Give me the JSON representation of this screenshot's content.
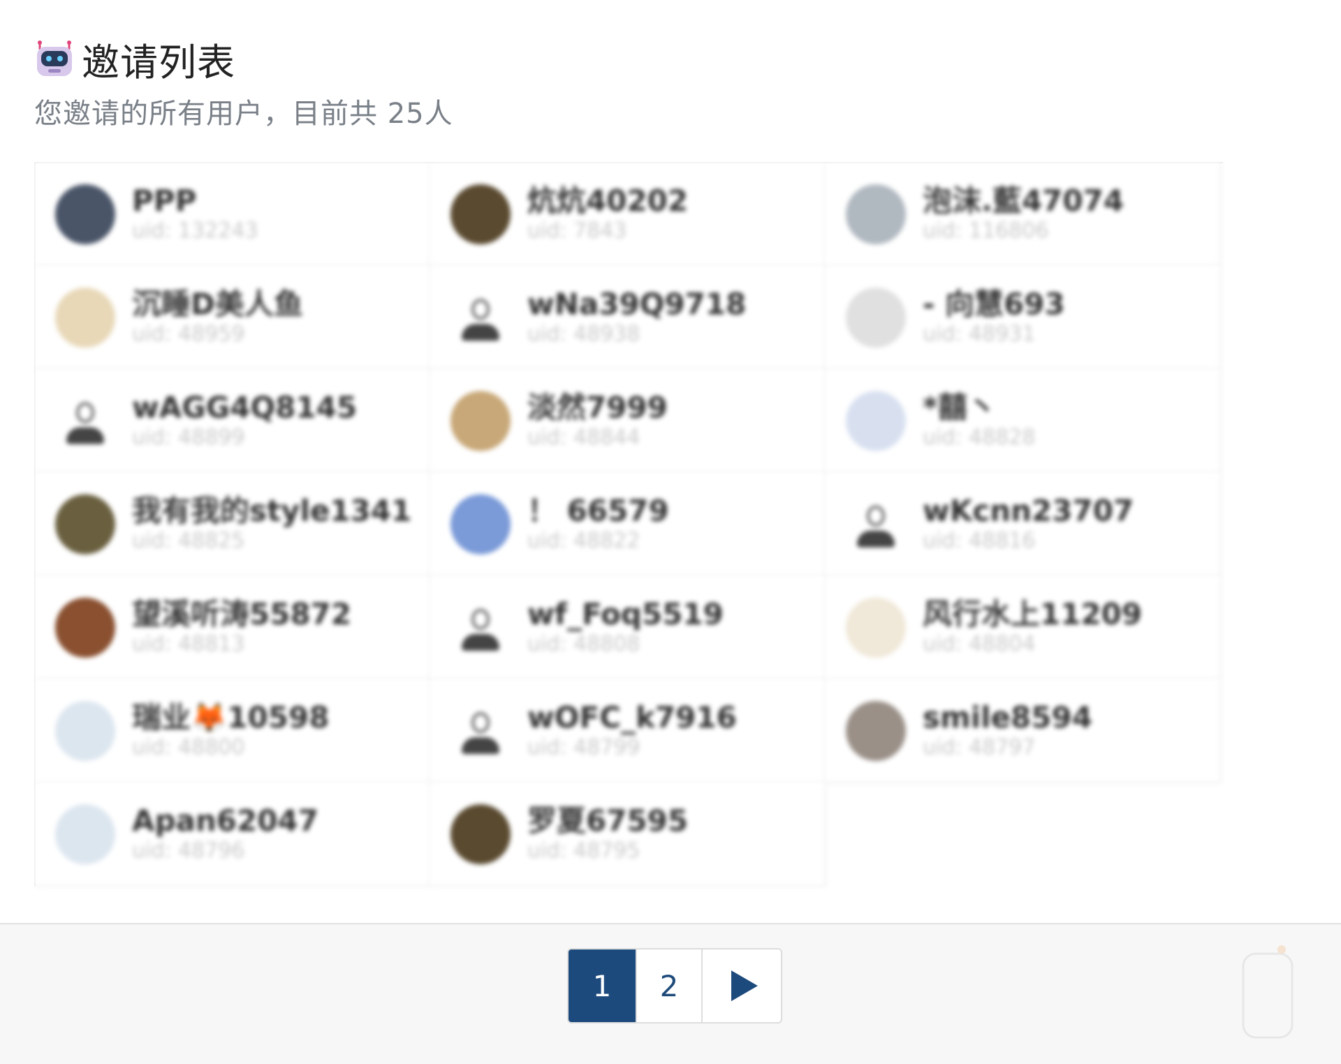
{
  "header": {
    "icon": "robot-icon",
    "title": "邀请列表",
    "subtitle": "您邀请的所有用户，目前共 25人"
  },
  "invites": [
    {
      "name": "PPP",
      "uid": "uid: 132243",
      "avatar": "photo-icon",
      "color": "#4a5568"
    },
    {
      "name": "炕炕40202",
      "uid": "uid: 7843",
      "avatar": "photo-icon",
      "color": "#5a4a30"
    },
    {
      "name": "泡沫.藍47074",
      "uid": "uid: 116806",
      "avatar": "photo-icon",
      "color": "#b0b8c0"
    },
    {
      "name": "沉睡D美人鱼",
      "uid": "uid: 48959",
      "avatar": "photo-icon",
      "color": "#e8d8b8"
    },
    {
      "name": "wNa39Q9718",
      "uid": "uid: 48938",
      "avatar": "default-user-icon",
      "color": "#ffffff"
    },
    {
      "name": "- 向慧693",
      "uid": "uid: 48931",
      "avatar": "photo-icon",
      "color": "#e0e0e0"
    },
    {
      "name": "wAGG4Q8145",
      "uid": "uid: 48899",
      "avatar": "default-user-icon",
      "color": "#ffffff"
    },
    {
      "name": "淡然7999",
      "uid": "uid: 48844",
      "avatar": "photo-icon",
      "color": "#c8a878"
    },
    {
      "name": "*囍丶",
      "uid": "uid: 48828",
      "avatar": "photo-icon",
      "color": "#d8e0f0"
    },
    {
      "name": "我有我的style1341",
      "uid": "uid: 48825",
      "avatar": "photo-icon",
      "color": "#6a6040"
    },
    {
      "name": "！ 66579",
      "uid": "uid: 48822",
      "avatar": "photo-icon",
      "color": "#7a9ad8"
    },
    {
      "name": "wKcnn23707",
      "uid": "uid: 48816",
      "avatar": "default-user-icon",
      "color": "#ffffff"
    },
    {
      "name": "望溪听涛55872",
      "uid": "uid: 48813",
      "avatar": "photo-icon",
      "color": "#8a5030"
    },
    {
      "name": "wf_Foq5519",
      "uid": "uid: 48808",
      "avatar": "default-user-icon",
      "color": "#ffffff"
    },
    {
      "name": "风行水上11209",
      "uid": "uid: 48804",
      "avatar": "photo-icon",
      "color": "#f0e8d8"
    },
    {
      "name": "瑞业🦊10598",
      "uid": "uid: 48800",
      "avatar": "photo-icon",
      "color": "#dce6ef"
    },
    {
      "name": "wOFC_k7916",
      "uid": "uid: 48799",
      "avatar": "default-user-icon",
      "color": "#ffffff"
    },
    {
      "name": "smile8594",
      "uid": "uid: 48797",
      "avatar": "photo-icon",
      "color": "#9a9088"
    },
    {
      "name": "Apan62047",
      "uid": "uid: 48796",
      "avatar": "photo-icon",
      "color": "#dce6ef"
    },
    {
      "name": "罗夏67595",
      "uid": "uid: 48795",
      "avatar": "photo-icon",
      "color": "#5a4a30"
    }
  ],
  "pagination": {
    "pages": [
      "1",
      "2"
    ],
    "current": "1",
    "next_icon": "play-arrow-icon"
  },
  "colors": {
    "accent": "#1d4a7c",
    "title": "#222222",
    "subtitle": "#7a8088",
    "border": "#ececec",
    "footer_bg": "#f7f7f7"
  }
}
